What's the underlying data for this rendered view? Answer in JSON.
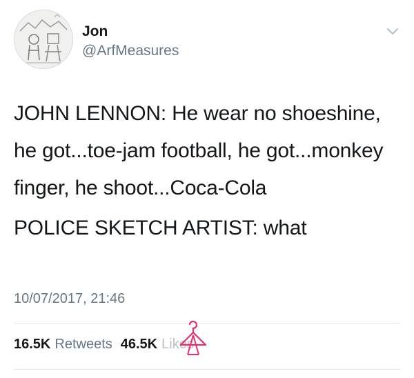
{
  "author": {
    "name": "Jon",
    "handle": "@ArfMeasures",
    "avatar_icon": "drawing-avatar-icon"
  },
  "menu": {
    "icon": "chevron-down-icon"
  },
  "tweet": {
    "paragraphs": [
      "JOHN LENNON: He wear no shoeshine, he got...toe-jam football, he got...monkey finger, he shoot...Coca-Cola",
      "POLICE SKETCH ARTIST: what"
    ],
    "timestamp": "10/07/2017, 21:46"
  },
  "stats": {
    "retweets_count": "16.5K",
    "retweets_label": "Retweets",
    "likes_count": "46.5K",
    "likes_label": "Likes"
  },
  "watermark": {
    "icon": "hanger-icon",
    "color": "#e8306a"
  },
  "colors": {
    "text": "#14171a",
    "secondary": "#657786",
    "divider": "#e1e8ed"
  }
}
